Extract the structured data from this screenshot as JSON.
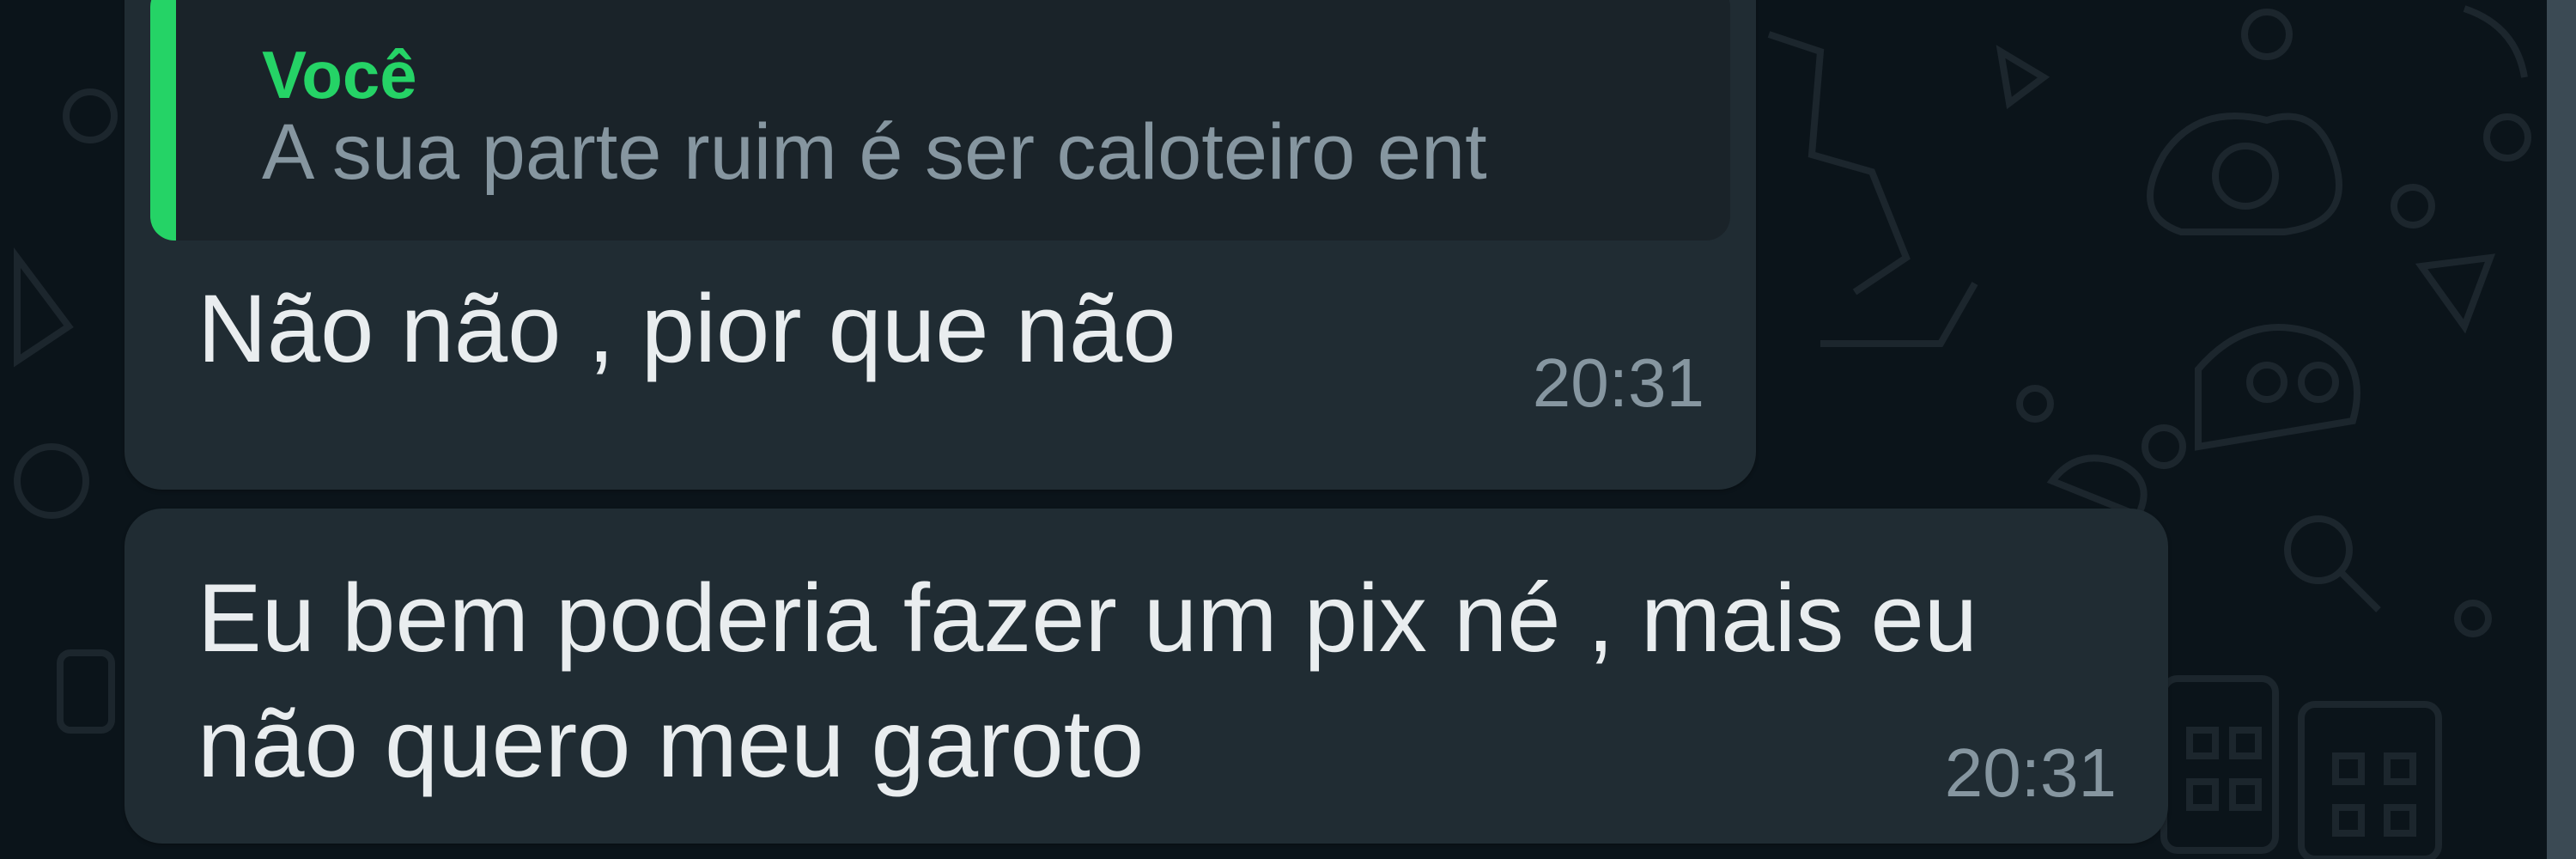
{
  "chat": {
    "messages": [
      {
        "quote": {
          "author": "Você",
          "text": "A sua parte ruim é ser caloteiro ent"
        },
        "text": "Não não , pior que não",
        "time": "20:31"
      },
      {
        "lines": [
          "Eu bem poderia fazer um pix né , mais eu",
          "não quero meu garoto"
        ],
        "time": "20:31"
      }
    ]
  },
  "colors": {
    "background": "#0b141a",
    "bubble": "#202c33",
    "quote_accent": "#25d366",
    "text": "#e9edef",
    "meta_text": "#8696a0"
  }
}
